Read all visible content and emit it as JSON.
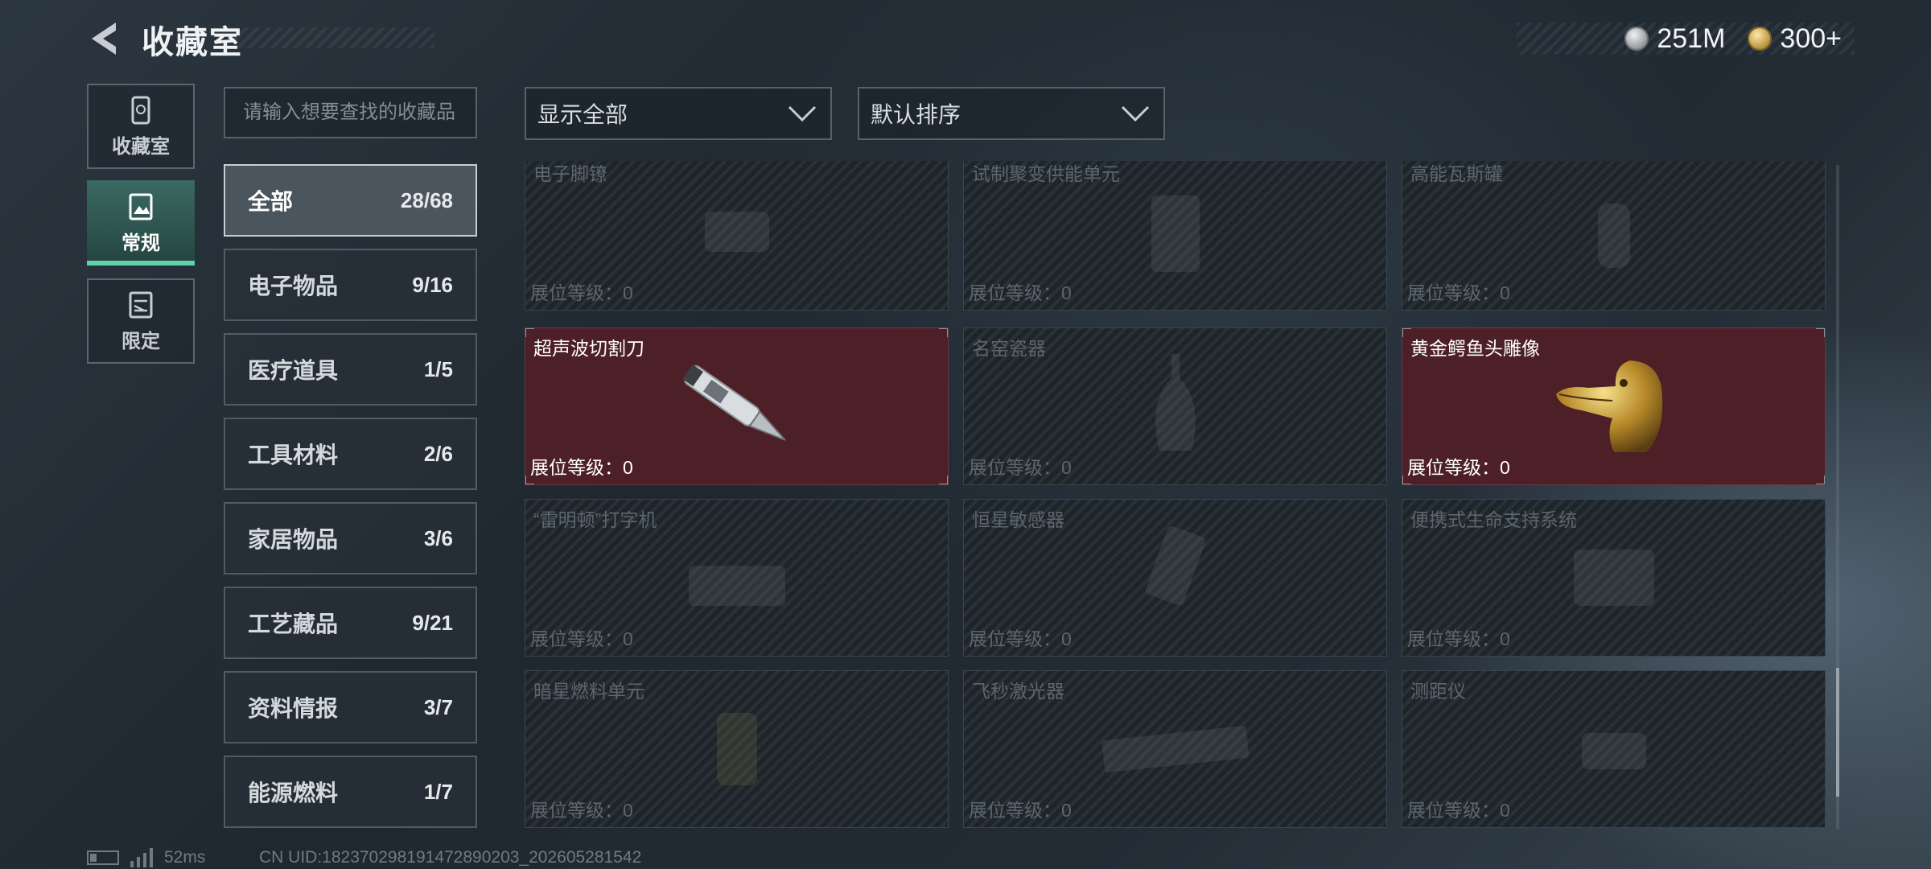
{
  "header": {
    "title": "收藏室",
    "currency": [
      {
        "icon": "silver-coin-icon",
        "value": "251M"
      },
      {
        "icon": "gold-coin-icon",
        "value": "300+"
      }
    ]
  },
  "left_nav": [
    {
      "label": "收藏室",
      "icon": "collection-room-icon",
      "active": false
    },
    {
      "label": "常规",
      "icon": "regular-icon",
      "active": true
    },
    {
      "label": "限定",
      "icon": "limited-icon",
      "active": false
    }
  ],
  "search": {
    "placeholder": "请输入想要查找的收藏品"
  },
  "categories": [
    {
      "name": "全部",
      "count": "28/68",
      "active": true
    },
    {
      "name": "电子物品",
      "count": "9/16"
    },
    {
      "name": "医疗道具",
      "count": "1/5"
    },
    {
      "name": "工具材料",
      "count": "2/6"
    },
    {
      "name": "家居物品",
      "count": "3/6"
    },
    {
      "name": "工艺藏品",
      "count": "9/21"
    },
    {
      "name": "资料情报",
      "count": "3/7"
    },
    {
      "name": "能源燃料",
      "count": "1/7"
    }
  ],
  "filters": {
    "show": "显示全部",
    "sort": "默认排序"
  },
  "items": [
    {
      "name": "电子脚镣",
      "level": "展位等级：0",
      "owned": false
    },
    {
      "name": "试制聚变供能单元",
      "level": "展位等级：0",
      "owned": false
    },
    {
      "name": "高能瓦斯罐",
      "level": "展位等级：0",
      "owned": false
    },
    {
      "name": "超声波切割刀",
      "level": "展位等级：0",
      "owned": true
    },
    {
      "name": "名窑瓷器",
      "level": "展位等级：0",
      "owned": false
    },
    {
      "name": "黄金鳄鱼头雕像",
      "level": "展位等级：0",
      "owned": true
    },
    {
      "name": "“雷明顿”打字机",
      "level": "展位等级：0",
      "owned": false
    },
    {
      "name": "恒星敏感器",
      "level": "展位等级：0",
      "owned": false
    },
    {
      "name": "便携式生命支持系统",
      "level": "展位等级：0",
      "owned": false
    },
    {
      "name": "暗星燃料单元",
      "level": "展位等级：0",
      "owned": false
    },
    {
      "name": "飞秒激光器",
      "level": "展位等级：0",
      "owned": false
    },
    {
      "name": "测距仪",
      "level": "展位等级：0",
      "owned": false
    }
  ],
  "footer": {
    "ping": "52ms",
    "uid": "CN UID:18237029819147289020​3_202605281542"
  },
  "colors": {
    "owned_card": "#4d1f26",
    "active_tab": "#5fd3a8"
  }
}
